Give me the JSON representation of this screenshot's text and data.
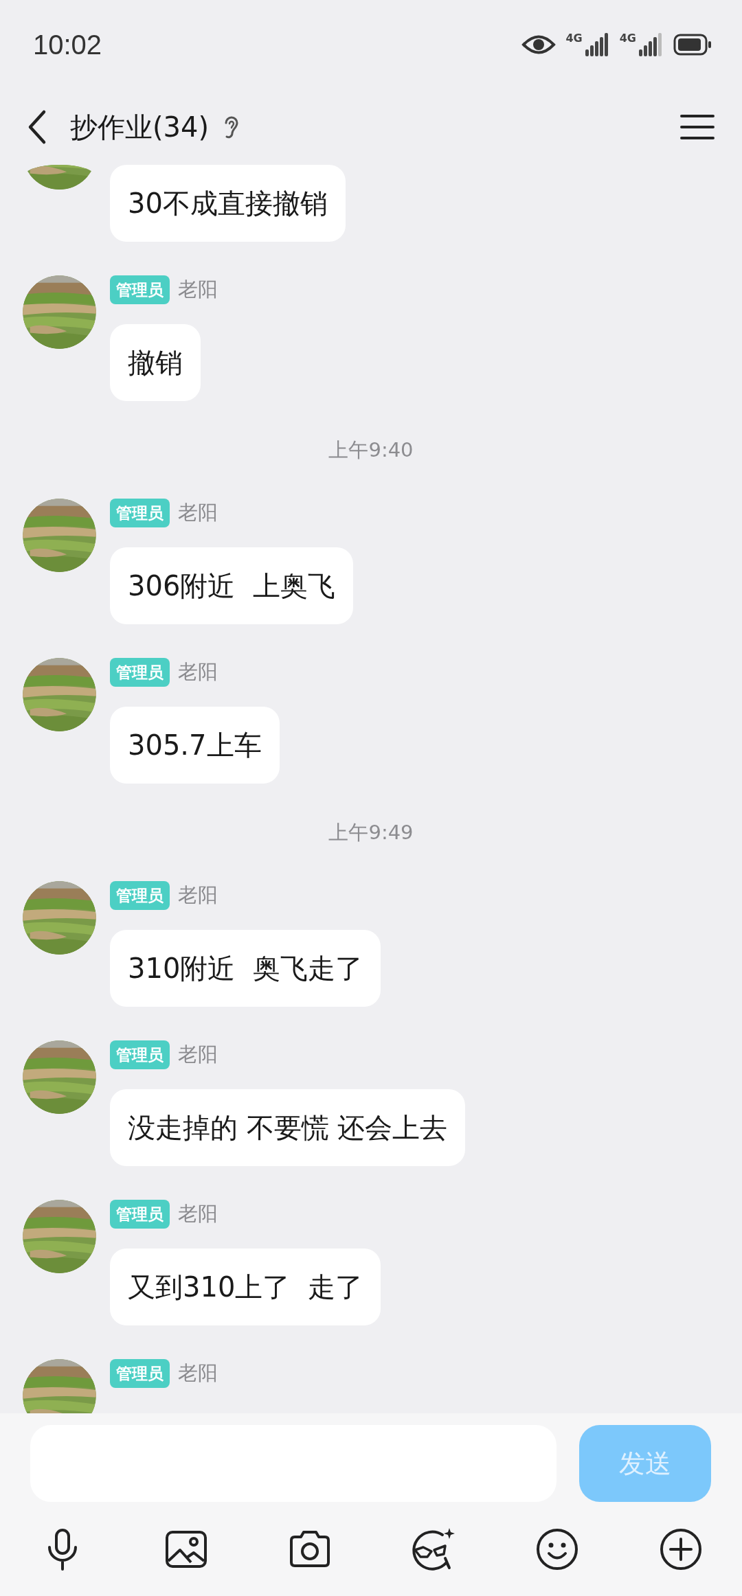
{
  "status_bar": {
    "time": "10:02",
    "networks": [
      {
        "label": "4G"
      },
      {
        "label": "4G"
      }
    ]
  },
  "header": {
    "title": "抄作业(34)"
  },
  "messages": [
    {
      "kind": "message",
      "text": "30不成直接撤销"
    },
    {
      "kind": "message",
      "badge": "管理员",
      "sender": "老阳",
      "text": "撤销"
    },
    {
      "kind": "time",
      "text": "上午9:40"
    },
    {
      "kind": "message",
      "badge": "管理员",
      "sender": "老阳",
      "text": "306附近  上奥飞"
    },
    {
      "kind": "message",
      "badge": "管理员",
      "sender": "老阳",
      "text": "305.7上车"
    },
    {
      "kind": "time",
      "text": "上午9:49"
    },
    {
      "kind": "message",
      "badge": "管理员",
      "sender": "老阳",
      "text": "310附近  奥飞走了"
    },
    {
      "kind": "message",
      "badge": "管理员",
      "sender": "老阳",
      "text": "没走掉的 不要慌 还会上去"
    },
    {
      "kind": "message",
      "badge": "管理员",
      "sender": "老阳",
      "text": "又到310上了  走了"
    },
    {
      "kind": "message",
      "badge": "管理员",
      "sender": "老阳"
    }
  ],
  "composer": {
    "send_button": {
      "label": "发送",
      "disabled": true
    }
  }
}
